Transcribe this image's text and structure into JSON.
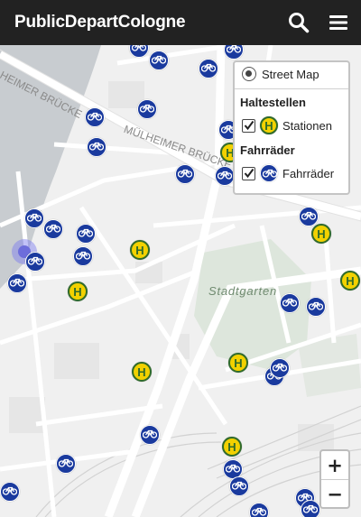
{
  "header": {
    "title": "PublicDepartCologne",
    "search_icon": "search-icon",
    "menu_icon": "hamburger-menu-icon",
    "background": "#222222"
  },
  "map": {
    "street_labels": [
      "HEIMER BRÜCKE",
      "MÜLHEIMER BRÜCKE"
    ],
    "park_label": "Stadtgarten",
    "stop_symbol": "H",
    "colors": {
      "bike": "#1a3a9e",
      "stop_fill": "#f2d100",
      "stop_border": "#2f6b2a",
      "water": "#c8ccd0",
      "park": "#dde6dc",
      "location": "#6d6ddb"
    }
  },
  "layer_control": {
    "base_layer_label": "Street Map",
    "group_stops": "Haltestellen",
    "stops_label": "Stationen",
    "stops_checked": true,
    "group_bikes": "Fahrräder",
    "bikes_label": "Fahrräder",
    "bikes_checked": true
  },
  "zoom": {
    "in_label": "+",
    "out_label": "−"
  }
}
